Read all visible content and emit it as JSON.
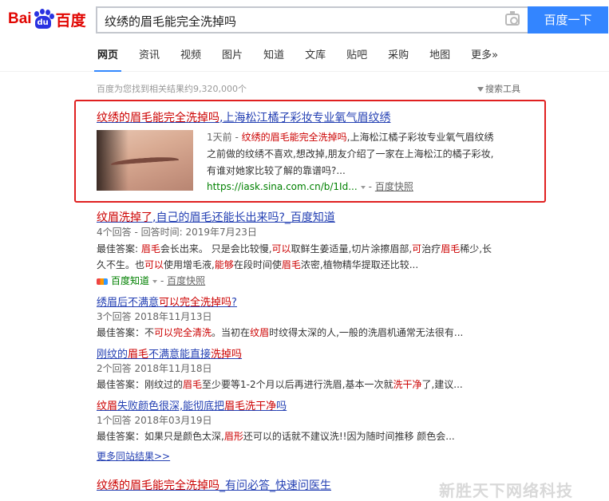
{
  "logo": {
    "text_a": "Bai",
    "text_b": "du",
    "text_c": "百度"
  },
  "search": {
    "query": "纹绣的眉毛能完全洗掉吗",
    "button": "百度一下"
  },
  "tabs": [
    "网页",
    "资讯",
    "视频",
    "图片",
    "知道",
    "文库",
    "贴吧",
    "采购",
    "地图",
    "更多»"
  ],
  "result_count": "百度为您找到相关结果约9,320,000个",
  "search_tools": "搜索工具",
  "results": [
    {
      "title_pre": "纹绣的眉毛能完全洗掉吗",
      "title_post": ",上海松江橘子彩妆专业氧气眉纹绣",
      "date": "1天前 - ",
      "snip1_em": "纹绣的眉毛能完全洗掉吗",
      "snip1_post": ",上海松江橘子彩妆专业氧气眉纹绣",
      "snip2": "之前做的纹绣不喜欢,想改掉,朋友介绍了一家在上海松江的橘子彩妆,",
      "snip3": "有谁对她家比较了解的靠谱吗?...",
      "url": "https://iask.sina.com.cn/b/1Id...",
      "snapshot": "百度快照"
    },
    {
      "title_pre": "纹眉洗掉了",
      "title_mid": ",自己的眉毛还能",
      "title_post": "长出来吗?_百度知道",
      "meta": "4个回答 - 回答时间: 2019年7月23日",
      "line1_a": "最佳答案: ",
      "line1_b": "眉毛",
      "line1_c": "会长出来。 只是会比较慢,",
      "line1_d": "可以",
      "line1_e": "取鲜生姜适量,切片涂擦眉部,",
      "line1_f": "可",
      "line1_g": "治疗",
      "line1_h": "眉毛",
      "line1_i": "稀少,长",
      "line2_a": "久不生。也",
      "line2_b": "可以",
      "line2_c": "使用增毛液,",
      "line2_d": "能够",
      "line2_e": "在段时间使",
      "line2_f": "眉毛",
      "line2_g": "浓密,植物精华提取还比较...",
      "source": "百度知道",
      "snapshot": "百度快照"
    },
    {
      "title_a": "绣眉后不满意",
      "title_b": "可以",
      "title_c": "完全洗掉吗",
      "title_d": "?",
      "meta": "3个回答 2018年11月13日",
      "line_a": "最佳答案：不",
      "line_b": "可以完全",
      "line_c": "清洗",
      "line_d": "。当初在",
      "line_e": "纹眉",
      "line_f": "时纹得太深的人,一般的洗眉机通常无法很有..."
    },
    {
      "title_a": "刚纹的",
      "title_b": "眉毛",
      "title_c": "不满意能直接",
      "title_d": "洗掉吗",
      "meta": "2个回答 2018年11月18日",
      "line_a": "最佳答案：刚纹过的",
      "line_b": "眉毛",
      "line_c": "至少要等1-2个月以后再进行洗眉,基本一次就",
      "line_d": "洗干净",
      "line_e": "了,建议..."
    },
    {
      "title_a": "纹眉",
      "title_b": "失败颜色很深,能彻底把",
      "title_c": "眉毛洗干净",
      "title_d": "吗",
      "meta": "1个回答 2018年03月19日",
      "line_a": "最佳答案：如果只是颜色太深,",
      "line_b": "眉形",
      "line_c": "还可以的话就不建议洗!!因为随时间推移 颜色会..."
    }
  ],
  "more_same_site": "更多同站结果>>",
  "last_result": {
    "title_pre": "纹绣的眉毛能完全洗掉吗",
    "title_post": "_有问必答_快速问医生"
  },
  "watermark": "新胜天下网络科技"
}
